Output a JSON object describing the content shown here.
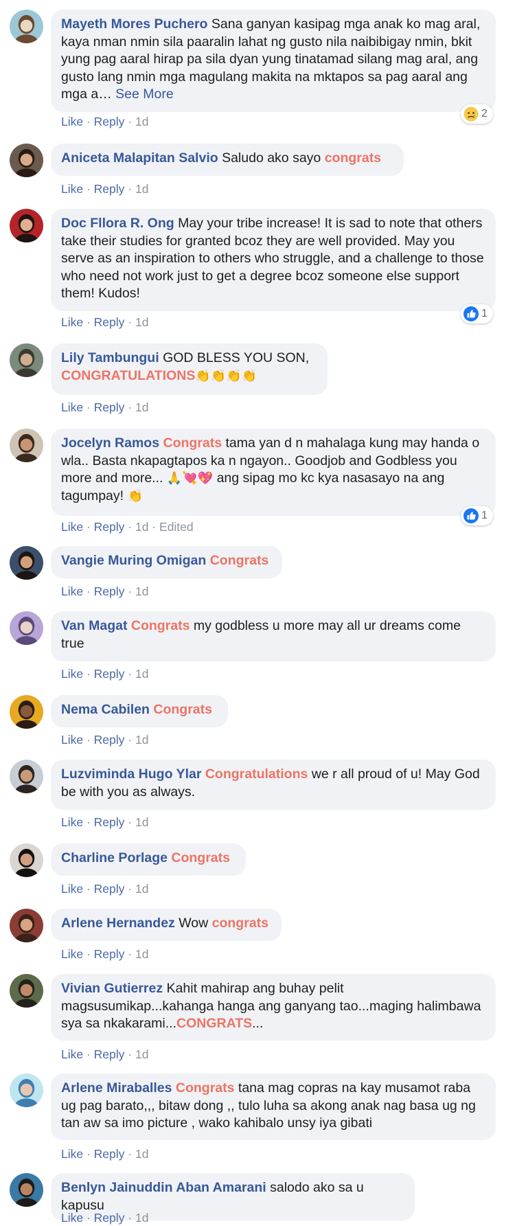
{
  "comments": [
    {
      "author": "Mayeth Mores Puchero",
      "body": [
        {
          "text": "Sana ganyan kasipag mga anak ko mag aral, kaya nman nmin sila paaralin lahat ng gusto nila naibibigay nmin, bkit yung pag aaral hirap pa sila dyan yung tinatamad silang mag aral, ang gusto lang nmin mga magulang makita na mktapos sa pag aaral ang mga a… "
        },
        {
          "text": "See More",
          "style": "link"
        }
      ],
      "actions": {
        "like": "Like",
        "reply": "Reply",
        "time": "1d"
      },
      "reaction": {
        "type": "sad",
        "icon": "sad-face-icon",
        "count": "2"
      },
      "avatar": {
        "bg": "#9cc7d6",
        "fg": "#e8d7c3",
        "hair": "#6b4a2e"
      }
    },
    {
      "author": "Aniceta Malapitan Salvio",
      "body": [
        {
          "text": "Saludo ako sayo "
        },
        {
          "text": "congrats",
          "style": "hl"
        }
      ],
      "actions": {
        "like": "Like",
        "reply": "Reply",
        "time": "1d"
      },
      "avatar": {
        "bg": "#6b5a4e",
        "fg": "#d9a989",
        "hair": "#2a1c14"
      }
    },
    {
      "author": "Doc Fllora R. Ong",
      "body": [
        {
          "text": "May your tribe increase! It is sad to note that others take their studies for granted bcoz they are well provided. May you serve as an inspiration to others who struggle, and a challenge to those who need not work just to get a degree bcoz someone else support them! Kudos!"
        }
      ],
      "actions": {
        "like": "Like",
        "reply": "Reply",
        "time": "1d"
      },
      "reaction": {
        "type": "like",
        "icon": "thumbs-up-icon",
        "count": "1"
      },
      "avatar": {
        "bg": "#b5242a",
        "fg": "#e2b08f",
        "hair": "#1e1410"
      }
    },
    {
      "author": "Lily Tambungui",
      "body": [
        {
          "text": "GOD BLESS YOU SON, "
        },
        {
          "text": "CONGRATULATIONS",
          "style": "hl"
        },
        {
          "text": "👏👏👏👏",
          "style": "emoji"
        }
      ],
      "actions": {
        "like": "Like",
        "reply": "Reply",
        "time": "1d"
      },
      "avatar": {
        "bg": "#7a8a7d",
        "fg": "#cfae8e",
        "hair": "#3a3a32"
      }
    },
    {
      "author": "Jocelyn Ramos",
      "body": [
        {
          "text": "Congrats",
          "style": "hl"
        },
        {
          "text": " tama yan d n mahalaga kung may handa o wla.. Basta nkapagtapos ka n ngayon.. Goodjob and Godbless you more and more... "
        },
        {
          "text": "🙏💘💖",
          "style": "emoji"
        },
        {
          "text": " ang sipag mo kc kya nasasayo na ang tagumpay! "
        },
        {
          "text": "👏",
          "style": "emoji"
        }
      ],
      "actions": {
        "like": "Like",
        "reply": "Reply",
        "time": "1d",
        "edited": "Edited"
      },
      "reaction": {
        "type": "like",
        "icon": "thumbs-up-icon",
        "count": "1"
      },
      "avatar": {
        "bg": "#cfc3b4",
        "fg": "#c89572",
        "hair": "#3b2a20"
      }
    },
    {
      "author": "Vangie Muring Omigan",
      "body": [
        {
          "text": "Congrats",
          "style": "hl"
        }
      ],
      "actions": {
        "like": "Like",
        "reply": "Reply",
        "time": "1d"
      },
      "avatar": {
        "bg": "#3c4f6a",
        "fg": "#d2a07c",
        "hair": "#1d1512"
      }
    },
    {
      "author": "Van Magat",
      "body": [
        {
          "text": "Congrats",
          "style": "hl"
        },
        {
          "text": " my godbless u more may all ur dreams come true"
        }
      ],
      "actions": {
        "like": "Like",
        "reply": "Reply",
        "time": "1d"
      },
      "avatar": {
        "bg": "#b9a6d8",
        "fg": "#e9d3c4",
        "hair": "#5a4a7a"
      }
    },
    {
      "author": "Nema Cabilen",
      "body": [
        {
          "text": "Congrats",
          "style": "hl"
        }
      ],
      "actions": {
        "like": "Like",
        "reply": "Reply",
        "time": "1d"
      },
      "avatar": {
        "bg": "#e6a91f",
        "fg": "#8a5a3c",
        "hair": "#2b1d16"
      }
    },
    {
      "author": "Luzviminda Hugo Ylar",
      "body": [
        {
          "text": "Congratulations",
          "style": "hl"
        },
        {
          "text": " we r all proud of u! May God be with you as always."
        }
      ],
      "actions": {
        "like": "Like",
        "reply": "Reply",
        "time": "1d"
      },
      "avatar": {
        "bg": "#c6cdd6",
        "fg": "#c99a78",
        "hair": "#2c2420"
      }
    },
    {
      "author": "Charline Porlage",
      "body": [
        {
          "text": "Congrats",
          "style": "hl"
        }
      ],
      "actions": {
        "like": "Like",
        "reply": "Reply",
        "time": "1d"
      },
      "avatar": {
        "bg": "#d9d6d2",
        "fg": "#cf9f7f",
        "hair": "#141012"
      }
    },
    {
      "author": "Arlene Hernandez",
      "body": [
        {
          "text": "Wow "
        },
        {
          "text": "congrats",
          "style": "hl"
        }
      ],
      "actions": {
        "like": "Like",
        "reply": "Reply",
        "time": "1d"
      },
      "avatar": {
        "bg": "#8a3c35",
        "fg": "#d7a584",
        "hair": "#3a221a"
      }
    },
    {
      "author": "Vivian Gutierrez",
      "body": [
        {
          "text": "Kahit mahirap ang buhay pelit magsusumikap...kahanga hanga ang ganyang tao...maging halimbawa sya sa nkakarami..."
        },
        {
          "text": "CONGRATS",
          "style": "hl"
        },
        {
          "text": "..."
        }
      ],
      "actions": {
        "like": "Like",
        "reply": "Reply",
        "time": "1d"
      },
      "avatar": {
        "bg": "#5c6b4a",
        "fg": "#c08a67",
        "hair": "#23211c"
      }
    },
    {
      "author": "Arlene Miraballes",
      "body": [
        {
          "text": "Congrats",
          "style": "hl"
        },
        {
          "text": " tana mag copras na kay musamot raba ug pag barato,,, bitaw dong ,, tulo luha sa akong anak nag basa ug ng tan aw sa imo picture , wako kahibalo unsy iya gibati"
        }
      ],
      "actions": {
        "like": "Like",
        "reply": "Reply",
        "time": "1d"
      },
      "avatar": {
        "bg": "#bfe6f0",
        "fg": "#e8c6b1",
        "hair": "#3f7fb0"
      }
    },
    {
      "author": "Benlyn Jainuddin Aban Amarani",
      "body": [
        {
          "text": "salodo ako sa u kapusu"
        }
      ],
      "actions": {
        "like": "Like",
        "reply": "Reply",
        "time": "1d"
      },
      "avatar": {
        "bg": "#3b7aa5",
        "fg": "#b88562",
        "hair": "#1c1a1a"
      }
    }
  ]
}
